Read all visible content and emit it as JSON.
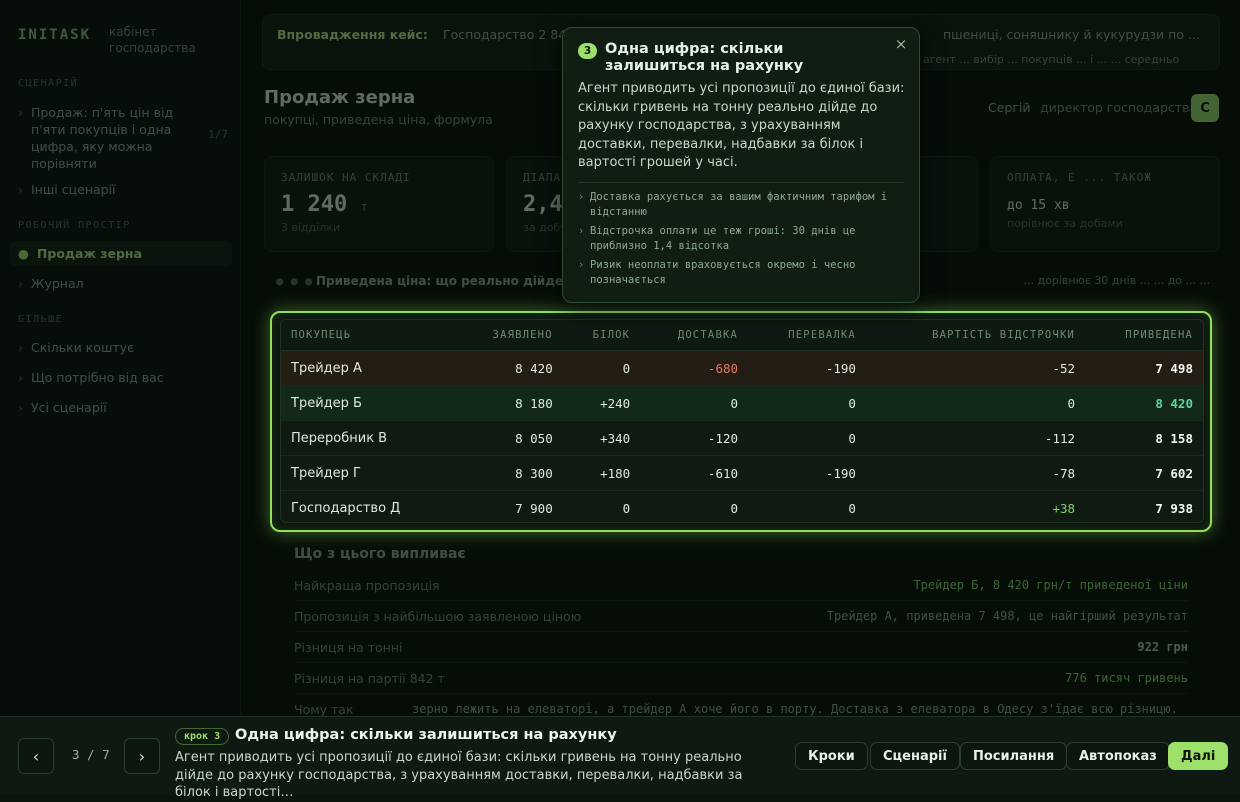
{
  "sidebar": {
    "logo": "INITASK",
    "subtitle": "кабінет господарства",
    "section_scenario": "СЦЕНАРІЙ",
    "scenario_item": "Продаж: п'ять цін від п'яти покупців і одна цифра, яку можна порівняти",
    "scenario_count": "1/7",
    "other_scenarios": "Інші сценарії",
    "section_workspace": "РОБОЧИЙ ПРОСТІР",
    "items": [
      {
        "label": "Продаж зерна",
        "active": true
      },
      {
        "label": "Журнал",
        "active": false
      }
    ],
    "section_more": "БІЛЬШЕ",
    "more_items": [
      "Скільки коштує",
      "Що потрібно від вас",
      "Усі сценарії"
    ]
  },
  "topbar": {
    "title": "Впровадження кейс:",
    "text": "Господарство 2 840 га ...",
    "right": "пшениці, соняшнику й кукурудзи по ...",
    "right2": "агент ... вибір ... покупців ... і ... ... середньо"
  },
  "header": {
    "title": "Продаж зерна",
    "subtitle": "покупці, приведена ціна, формула",
    "user_name": "Сергій",
    "user_role": "директор господарства",
    "avatar_letter": "С"
  },
  "kpis": [
    {
      "label": "ЗАЛИШОК НА СКЛАДІ",
      "value": "1 240",
      "unit": "т",
      "note": "3 відділки"
    },
    {
      "label": "ДІАПАЗОН ЦІН",
      "value": "2,4",
      "unit": "",
      "note": "за добу"
    },
    {
      "label": "ОПЛАТА, Е ... ТАКОЖ",
      "value": "",
      "unit": "",
      "note": ""
    },
    {
      "label": "ОПЛАТА, Е ... ТАКОЖ",
      "value": "до 15 хв",
      "unit": "",
      "note": "порівнює за добами"
    }
  ],
  "hint": {
    "left_prefix": "● ● ●",
    "left": "Приведена ціна: що реально дійде до ...",
    "right": "... дорівнює 30 днів ... ... до ... ..."
  },
  "table": {
    "headers": [
      "ПОКУПЕЦЬ",
      "ЗАЯВЛЕНО",
      "БІЛОК",
      "ДОСТАВКА",
      "ПЕРЕВАЛКА",
      "ВАРТІСТЬ ВІДСТРОЧКИ",
      "ПРИВЕДЕНА"
    ],
    "rows": [
      {
        "buyer": "Трейдер А",
        "declared": "8 420",
        "protein": "0",
        "delivery": "-680",
        "transship": "-190",
        "deferral": "-52",
        "total": "7 498",
        "style": "warn"
      },
      {
        "buyer": "Трейдер Б",
        "declared": "8 180",
        "protein": "+240",
        "delivery": "0",
        "transship": "0",
        "deferral": "0",
        "total": "8 420",
        "style": "best"
      },
      {
        "buyer": "Переробник В",
        "declared": "8 050",
        "protein": "+340",
        "delivery": "-120",
        "transship": "0",
        "deferral": "-112",
        "total": "8 158",
        "style": ""
      },
      {
        "buyer": "Трейдер Г",
        "declared": "8 300",
        "protein": "+180",
        "delivery": "-610",
        "transship": "-190",
        "deferral": "-78",
        "total": "7 602",
        "style": ""
      },
      {
        "buyer": "Господарство Д",
        "declared": "7 900",
        "protein": "0",
        "delivery": "0",
        "transship": "0",
        "deferral": "+38",
        "total": "7 938",
        "style": ""
      }
    ]
  },
  "conclusions": {
    "title": "Що з цього випливає",
    "rows": [
      {
        "label": "Найкраща пропозиція",
        "value": "Трейдер Б, 8 420 грн/т приведеної ціни"
      },
      {
        "label": "Пропозиція з найбільшою заявленою ціною",
        "value": "Трейдер А, приведена 7 498, це найгірший результат"
      },
      {
        "label": "Різниця на тонні",
        "value": "922 грн"
      },
      {
        "label": "Різниця на партії 842 т",
        "value": "776 тисяч гривень"
      },
      {
        "label": "Чому так",
        "value": "зерно лежить на елеваторі, а трейдер А хоче його в порту. Доставка з елеватора в Одесу з'їдає всю різницю."
      }
    ]
  },
  "popover": {
    "step_number": "3",
    "title": "Одна цифра: скільки залишиться на рахунку",
    "close_label": "×",
    "body": "Агент приводить усі пропозиції до єдиної бази: скільки гривень на тонну реально дійде до рахунку господарства, з урахуванням доставки, перевалки, надбавки за білок і вартості грошей у часі.",
    "bullets": [
      "Доставка рахується за вашим фактичним тарифом і відстанню",
      "Відстрочка оплати це теж гроші: 30 днів це приблизно 1,4 відсотка",
      "Ризик неоплати враховується окремо і чесно позначається"
    ]
  },
  "tour": {
    "prev_label": "‹",
    "next_label": "›",
    "counter": "3 / 7",
    "step_badge": "крок 3",
    "title": "Одна цифра: скільки залишиться на рахунку",
    "description": "Агент приводить усі пропозиції до єдиної бази: скільки гривень на тонну реально дійде до рахунку господарства, з урахуванням доставки, перевалки, надбавки за білок і вартості…",
    "actions": {
      "steps": "Кроки",
      "scenarios": "Сценарії",
      "links": "Посилання",
      "autoplay": "Автопоказ",
      "next": "Далі"
    }
  },
  "colors": {
    "accent": "#9de06a",
    "negative": "#e07a5f",
    "positive": "#7fd46a",
    "best_total": "#5fd49a"
  }
}
